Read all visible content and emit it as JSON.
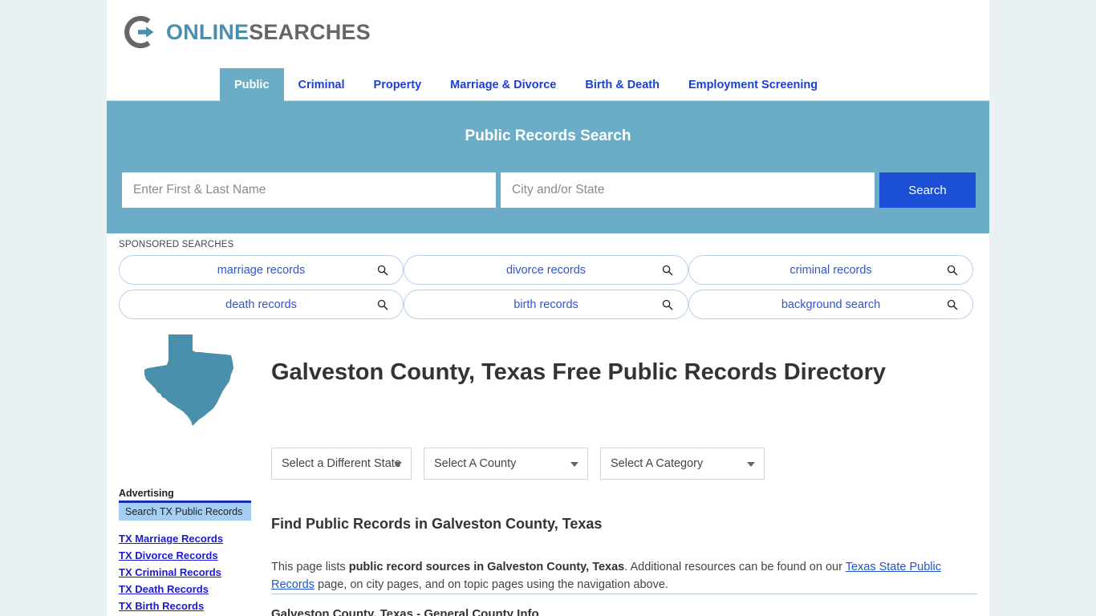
{
  "brand": {
    "name_part1": "ONLINE",
    "name_part2": "SEARCHES",
    "logo_icon": "circle-arrow-right-icon",
    "accent_color": "#4a8fac",
    "gray_color": "#666666"
  },
  "nav": {
    "tabs": [
      {
        "label": "Public",
        "active": true
      },
      {
        "label": "Criminal",
        "active": false
      },
      {
        "label": "Property",
        "active": false
      },
      {
        "label": "Marriage & Divorce",
        "active": false
      },
      {
        "label": "Birth & Death",
        "active": false
      },
      {
        "label": "Employment Screening",
        "active": false
      }
    ],
    "active_bg": "#6badc6",
    "link_color": "#1a3fd6"
  },
  "search_banner": {
    "title": "Public Records Search",
    "background_color": "#6badc6",
    "name_value": "",
    "name_placeholder": "Enter First & Last Name",
    "location_value": "",
    "location_placeholder": "City and/or State",
    "button_label": "Search",
    "button_color": "#1a4fd6"
  },
  "sponsored": {
    "label": "SPONSORED SEARCHES",
    "items": [
      {
        "label": "marriage records",
        "icon": "search-icon"
      },
      {
        "label": "divorce records",
        "icon": "search-icon"
      },
      {
        "label": "criminal records",
        "icon": "search-icon"
      },
      {
        "label": "death records",
        "icon": "search-icon"
      },
      {
        "label": "birth records",
        "icon": "search-icon"
      },
      {
        "label": "background search",
        "icon": "search-icon"
      }
    ]
  },
  "page": {
    "title": "Galveston County, Texas Free Public Records Directory",
    "state_map_icon": "texas-state-map-icon",
    "state_map_color": "#4a8fac"
  },
  "selectors": [
    {
      "name": "state",
      "label": "Select a Different State"
    },
    {
      "name": "county",
      "label": "Select A County"
    },
    {
      "name": "category",
      "label": "Select A Category"
    }
  ],
  "sidebar": {
    "heading": "Advertising",
    "box_label": "Search TX Public Records",
    "links": [
      {
        "label": "TX Marriage Records"
      },
      {
        "label": "TX Divorce Records"
      },
      {
        "label": "TX Criminal Records"
      },
      {
        "label": "TX Death Records"
      },
      {
        "label": "TX Birth Records"
      }
    ]
  },
  "main": {
    "section_heading": "Find Public Records in Galveston County, Texas",
    "paragraph": {
      "text_1": "This page lists ",
      "bold_1": "public record sources in Galveston County, Texas",
      "text_2": ". Additional resources can be found on our ",
      "link_1": "Texas State Public Records",
      "text_3": " page, on city pages, and on topic pages using the navigation above."
    },
    "sub_heading": "Galveston County, Texas - General County Info"
  }
}
